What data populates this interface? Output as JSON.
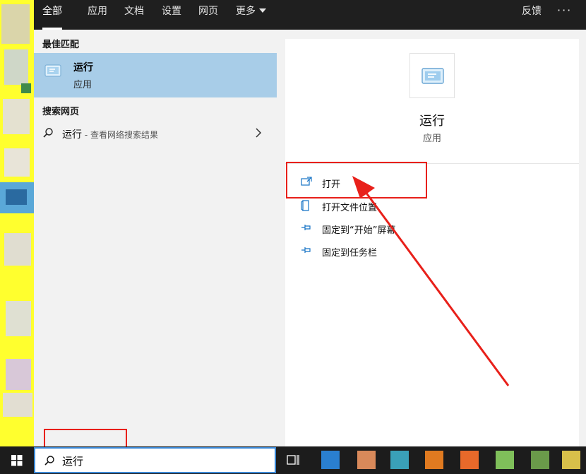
{
  "tabs": [
    {
      "label": "全部",
      "active": true
    },
    {
      "label": "应用",
      "active": false
    },
    {
      "label": "文档",
      "active": false
    },
    {
      "label": "设置",
      "active": false
    },
    {
      "label": "网页",
      "active": false
    },
    {
      "label": "更多",
      "active": false,
      "dropdown": true
    }
  ],
  "topbar": {
    "feedback": "反馈",
    "more_dots": "···"
  },
  "results": {
    "best_match_heading": "最佳匹配",
    "best_match": {
      "title": "运行",
      "subtitle": "应用",
      "icon": "run-app-icon"
    },
    "web_heading": "搜索网页",
    "web_query": "运行",
    "web_hint": " - 查看网络搜索结果"
  },
  "detail": {
    "title": "运行",
    "subtitle": "应用",
    "actions": [
      {
        "label": "打开",
        "icon": "open-icon"
      },
      {
        "label": "打开文件位置",
        "icon": "file-location-icon"
      },
      {
        "label": "固定到“开始”屏幕",
        "icon": "pin-icon"
      },
      {
        "label": "固定到任务栏",
        "icon": "pin-icon"
      }
    ]
  },
  "taskbar": {
    "search_value": "运行",
    "search_icon": "search-icon"
  },
  "colors": {
    "selected_bg": "#a8cde8",
    "annotation": "#e8201a",
    "accent": "#0078d7",
    "desktop": "#ffff2e"
  }
}
